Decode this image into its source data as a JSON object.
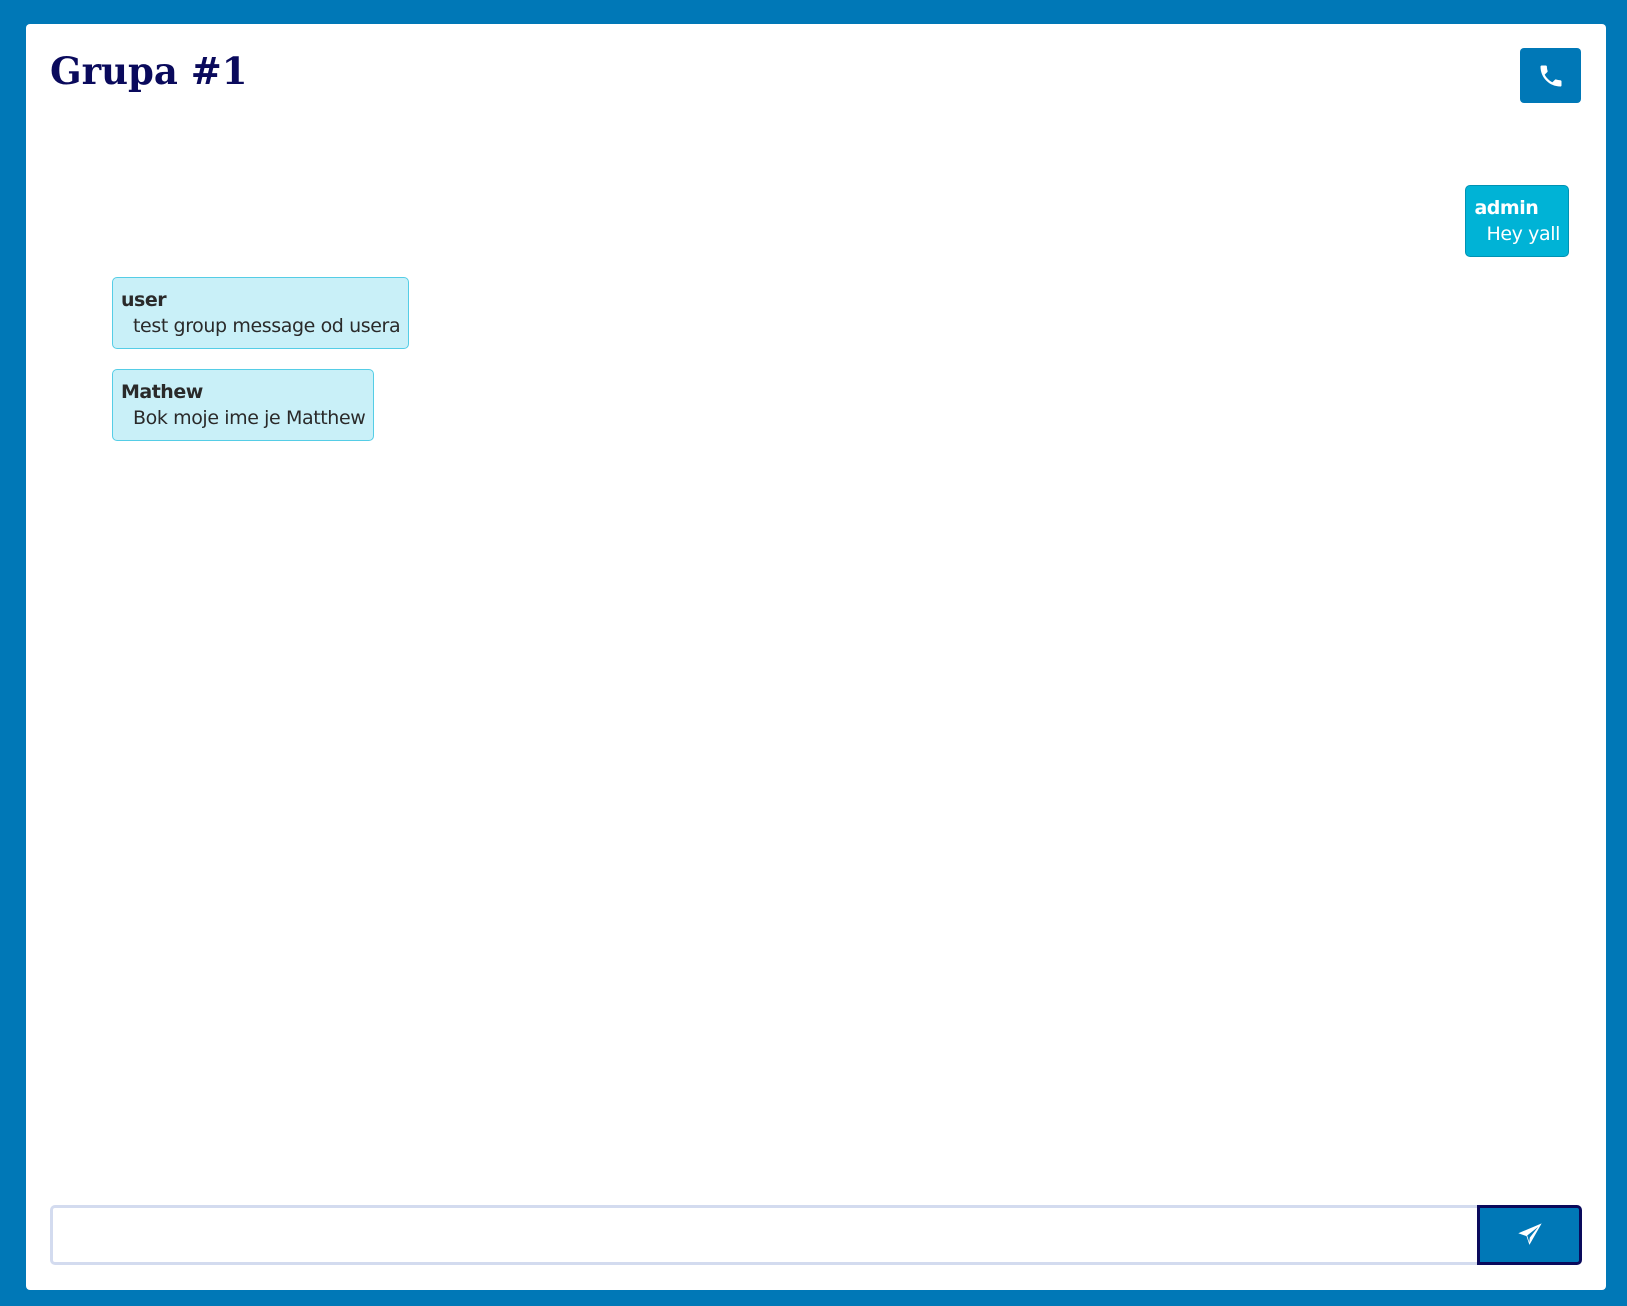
{
  "chat": {
    "title": "Grupa #1",
    "call_icon": "phone-icon",
    "send_icon": "paper-plane-icon"
  },
  "messages": [
    {
      "sender": "admin",
      "text": "Hey yall",
      "own": true
    },
    {
      "sender": "user",
      "text": "test group message od usera",
      "own": false
    },
    {
      "sender": "Mathew",
      "text": "Bok moje ime je Matthew",
      "own": false
    }
  ],
  "composer": {
    "value": "",
    "placeholder": ""
  },
  "colors": {
    "frame": "#0078b7",
    "title": "#0a0a5c",
    "own_bubble": "#00b3d6",
    "other_bubble": "#c9f0f8",
    "other_bubble_border": "#55cde6",
    "input_border": "#d3dbef"
  }
}
